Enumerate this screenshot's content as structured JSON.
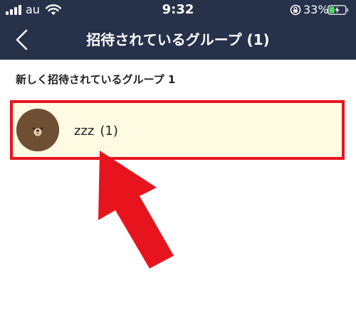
{
  "status_bar": {
    "carrier": "au",
    "time": "9:32",
    "battery_percent": "33%",
    "battery_level": 0.33,
    "icons": [
      "signal-icon",
      "wifi-icon",
      "orientation-lock-icon",
      "battery-icon"
    ]
  },
  "nav_bar": {
    "back_icon": "chevron-left-icon",
    "title": "招待されているグループ (1)"
  },
  "section": {
    "header": "新しく招待されているグループ 1"
  },
  "groups": [
    {
      "name": "zzz",
      "count": "(1)",
      "avatar_icon": "bear-avatar-icon"
    }
  ],
  "colors": {
    "nav_background": "#26314a",
    "highlight_border": "#e8141d",
    "row_background": "#fffbe2",
    "arrow": "#e8141d"
  }
}
